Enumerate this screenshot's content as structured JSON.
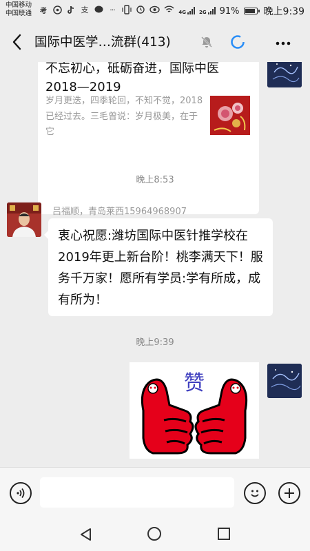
{
  "status_bar": {
    "carrier1": "中国移动",
    "carrier2": "中国联通",
    "left_icons": [
      "app-icon-1",
      "compass-icon",
      "tiktok-icon",
      "alipay-icon",
      "chat-bubble-icon",
      "more-dots-icon"
    ],
    "signal_labels": [
      "4G",
      "2G"
    ],
    "battery": "91%",
    "battery_level": 0.91,
    "time": "晚上9:39"
  },
  "navbar": {
    "title": "国际中医学…流群(413)"
  },
  "messages": {
    "link_card": {
      "title": "不忘初心，砥砺奋进，国际中医 2018—2019",
      "description": "岁月更迭，四季轮回，不知不觉，2018已经过去。三毛曾说：岁月极美，在于它"
    },
    "timestamp1": "晚上8:53",
    "sender_name": "吕福顺，青岛莱西15964968907",
    "text_message": "衷心祝愿:潍坊国际中医针推学校在2019年更上新台阶！桃李满天下！服务千万家！愿所有学员:学有所成，成有所为！",
    "timestamp2": "晚上9:39",
    "sticker_label": "赞"
  },
  "input_bar": {
    "placeholder": ""
  }
}
